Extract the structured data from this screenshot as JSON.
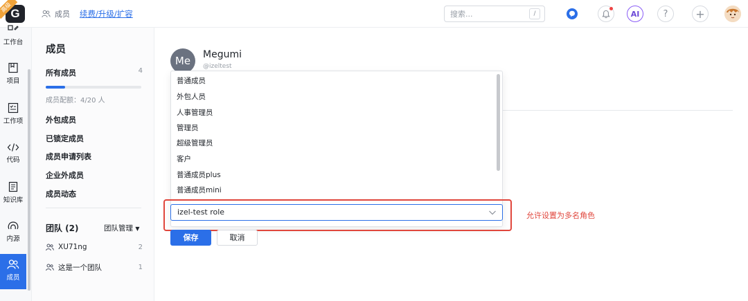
{
  "topbar": {
    "logo_letter": "G",
    "logo_badge": "高级",
    "breadcrumb": "成员",
    "breadcrumb_link": "续费/升级/扩容",
    "search_placeholder": "搜索...",
    "search_shortcut": "/",
    "ai_label": "AI",
    "help_label": "?",
    "add_label": "+"
  },
  "rail": {
    "items": [
      {
        "label": "工作台",
        "icon": "workbench-icon"
      },
      {
        "label": "项目",
        "icon": "project-icon"
      },
      {
        "label": "工作项",
        "icon": "workitem-icon"
      },
      {
        "label": "代码",
        "icon": "code-icon"
      },
      {
        "label": "知识库",
        "icon": "knowledge-icon"
      },
      {
        "label": "内源",
        "icon": "innersource-icon"
      },
      {
        "label": "成员",
        "icon": "members-icon",
        "active": true
      }
    ]
  },
  "side": {
    "title": "成员",
    "all_members": "所有成员",
    "all_members_count": "4",
    "quota_progress": 0.2,
    "quota_text": "成员配额：4/20 人",
    "links": [
      "外包成员",
      "已锁定成员",
      "成员申请列表",
      "企业外成员",
      "成员动态"
    ],
    "team_title": "团队 (2)",
    "team_manage": "团队管理",
    "teams": [
      {
        "name": "XU71ng",
        "count": "2"
      },
      {
        "name": "这是一个团队",
        "count": "1"
      }
    ]
  },
  "main": {
    "avatar_initials": "Me",
    "member_name": "Megumi",
    "member_id": "@izeltest",
    "role_options": [
      "普通成员",
      "外包人员",
      "人事管理员",
      "管理员",
      "超级管理员",
      "客户",
      "普通成员plus",
      "普通成员mini"
    ],
    "selected_role": "izel-test role",
    "annotation": "允许设置为多名角色",
    "save_label": "保存",
    "cancel_label": "取消"
  },
  "colors": {
    "accent": "#2b6fe8",
    "annotation_red": "#e0463c"
  }
}
